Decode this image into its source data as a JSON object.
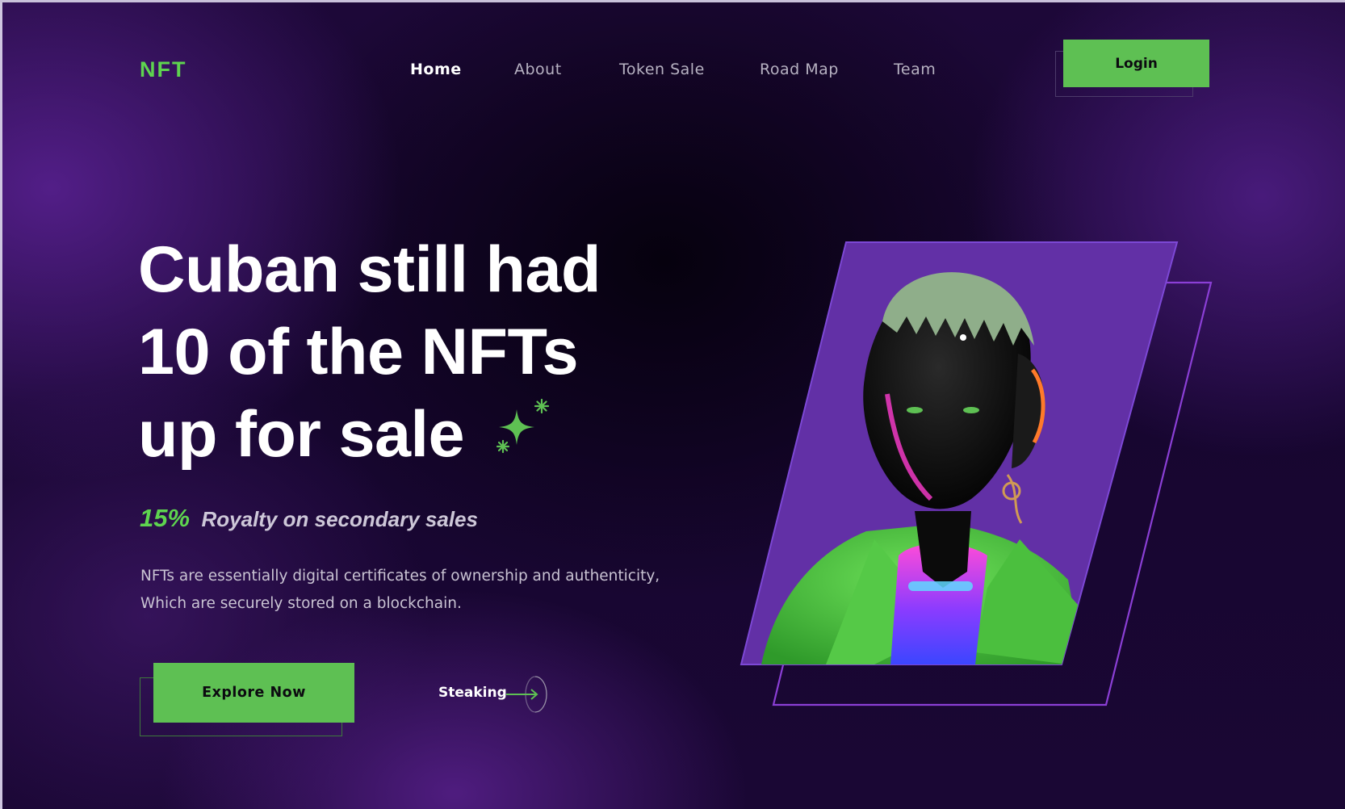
{
  "brand": {
    "logo_text": "NFT"
  },
  "nav": {
    "items": [
      {
        "label": "Home",
        "active": true
      },
      {
        "label": "About",
        "active": false
      },
      {
        "label": "Token Sale",
        "active": false
      },
      {
        "label": "Road Map",
        "active": false
      },
      {
        "label": "Team",
        "active": false
      }
    ],
    "login_label": "Login"
  },
  "hero": {
    "headline_lines": [
      "Cuban still had",
      "10 of the NFTs",
      "up for sale"
    ],
    "royalty_percent": "15%",
    "royalty_text": "Royalty on secondary sales",
    "description_lines": [
      "NFTs are essentially digital certificates of ownership and authenticity,",
      "Which are securely stored on a blockchain."
    ],
    "primary_cta": "Explore Now",
    "secondary_cta": "Steaking"
  },
  "colors": {
    "accent_green": "#5ec053",
    "logo_green": "#5ed44f",
    "frame_purple": "#6b34b8",
    "background": "#170630"
  },
  "icons": {
    "sparkle": "sparkle-icon",
    "arrow": "arrow-right-icon"
  }
}
